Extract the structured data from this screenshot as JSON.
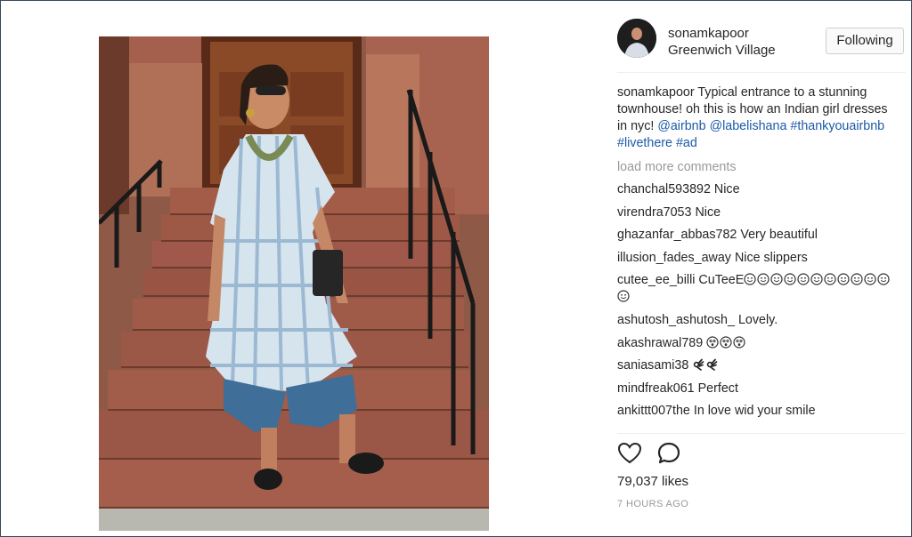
{
  "post": {
    "username": "sonamkapoor",
    "location": "Greenwich Village",
    "follow_label": "Following",
    "caption": {
      "user": "sonamkapoor",
      "text": "Typical entrance to a stunning townhouse! oh this is how an Indian girl dresses in nyc!",
      "tags": [
        "@airbnb",
        "@labelishana",
        "#thankyouairbnb",
        "#livethere",
        "#ad"
      ]
    },
    "load_more": "load more comments",
    "comments": [
      {
        "user": "chanchal593892",
        "text": "Nice"
      },
      {
        "user": "virendra7053",
        "text": "Nice"
      },
      {
        "user": "ghazanfar_abbas782",
        "text": "Very beautiful"
      },
      {
        "user": "illusion_fades_away",
        "text": "Nice slippers"
      },
      {
        "user": "cutee_ee_billi",
        "text": "CuTeeE",
        "emoji": "smiley",
        "emoji_count": 12
      },
      {
        "user": "ashutosh_ashutosh_",
        "text": "Lovely."
      },
      {
        "user": "akashrawal789",
        "text": "",
        "emoji": "astonished",
        "emoji_count": 3
      },
      {
        "user": "saniasami38",
        "text": "",
        "emoji": "ok-hand",
        "emoji_count": 2
      },
      {
        "user": "mindfreak061",
        "text": "Perfect"
      },
      {
        "user": "ankittt007the",
        "text": "In love wid your smile"
      }
    ],
    "likes": "79,037 likes",
    "time": "7 HOURS AGO",
    "icons": {
      "like": "heart-icon",
      "comment": "comment-icon"
    },
    "colors": {
      "link": "#1c5aa8",
      "muted": "#999999",
      "text": "#262626"
    }
  }
}
